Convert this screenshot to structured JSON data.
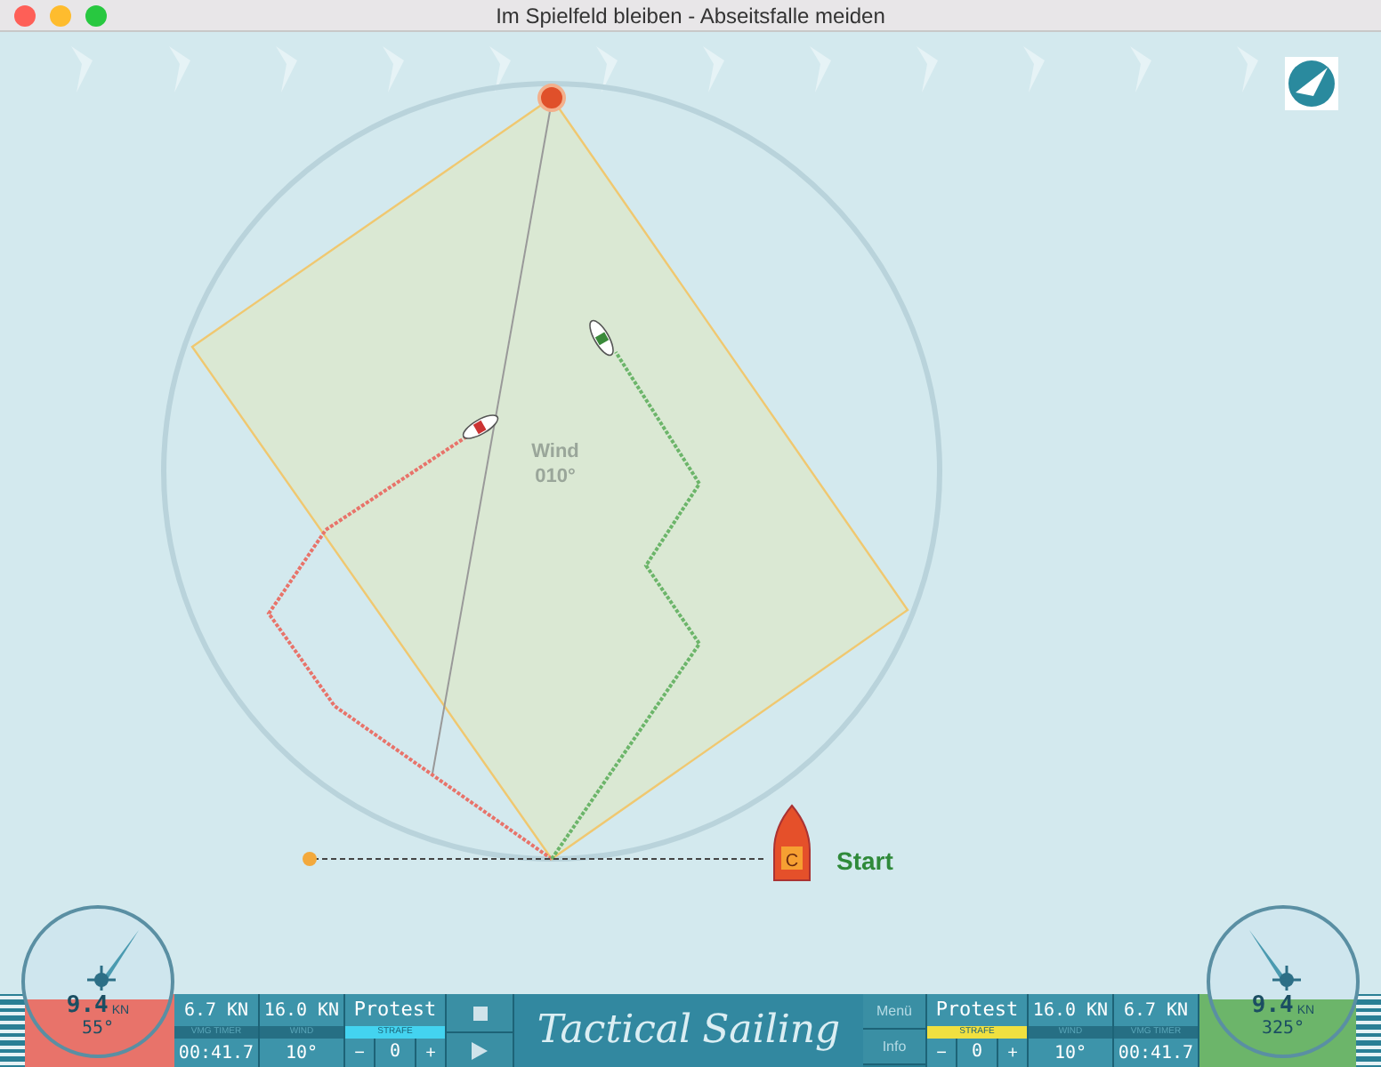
{
  "window": {
    "title": "Im Spielfeld bleiben - Abseitsfalle meiden"
  },
  "map": {
    "wind_label": "Wind",
    "wind_direction": "010°",
    "start_label": "Start",
    "committee_letter": "C"
  },
  "players": [
    {
      "kind": "left",
      "color": "#e8736a",
      "speed": "9.4",
      "speed_unit": "KN",
      "heading": "55°",
      "vmg": "6.7 KN",
      "vmg_label": "VMG TIMER",
      "timer": "00:41.7",
      "wind_speed": "16.0 KN",
      "wind_label": "WIND",
      "wind_angle": "10°",
      "protest": "Protest",
      "penalty": {
        "label": "STRAFE",
        "color": "#43d3f0",
        "minus": "−",
        "count": "0",
        "plus": "+"
      }
    },
    {
      "kind": "right",
      "color": "#6cb56a",
      "speed": "9.4",
      "speed_unit": "KN",
      "heading": "325°",
      "vmg": "6.7 KN",
      "vmg_label": "VMG TIMER",
      "timer": "00:41.7",
      "wind_speed": "16.0 KN",
      "wind_label": "WIND",
      "wind_angle": "10°",
      "protest": "Protest",
      "penalty": {
        "label": "STRAFE",
        "color": "#f0e040",
        "minus": "−",
        "count": "0",
        "plus": "+"
      }
    }
  ],
  "logo": {
    "line1": "Tactical",
    "line2": "Sailing"
  },
  "menu": [
    {
      "label": "Menü",
      "disabled": true
    },
    {
      "label": "Info",
      "disabled": true
    }
  ]
}
